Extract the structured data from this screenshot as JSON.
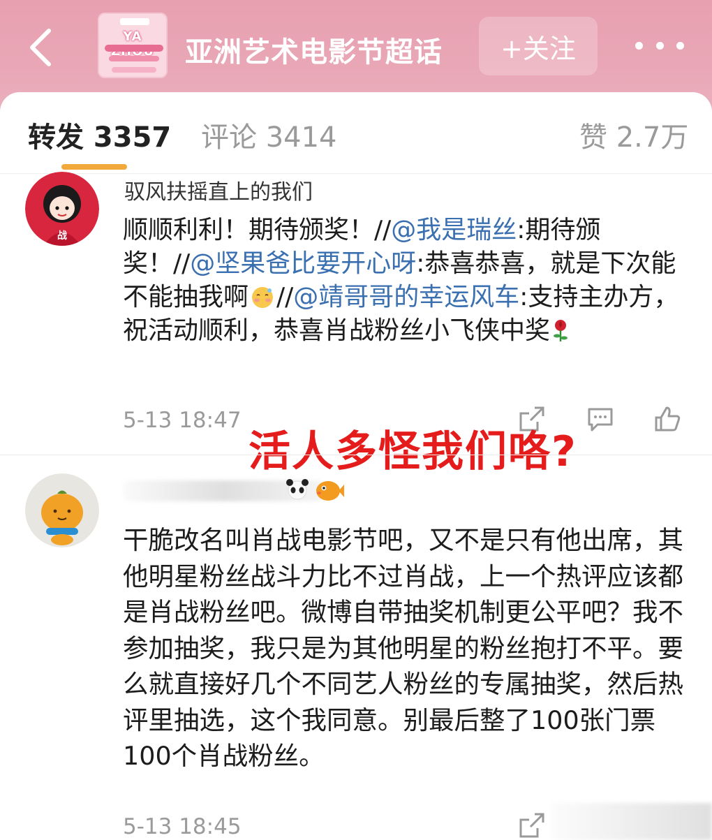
{
  "header": {
    "logo_text": "YA ZHOU",
    "title": "亚洲艺术电影节超话",
    "follow_label": "+关注"
  },
  "tabs": {
    "repost": "转发 3357",
    "comment": "评论 3414",
    "like": "赞 2.7万"
  },
  "posts": [
    {
      "author": "驭风扶摇直上的我们",
      "body": {
        "p1": "顺顺利利！期待颁奖！//",
        "m1": "@我是瑞丝",
        "p2": ":期待颁奖！//",
        "m2": "@坚果爸比要开心呀",
        "p3": ":恭喜恭喜，就是下次能不能抽我啊",
        "p4": "//",
        "m3": "@靖哥哥的幸运风车",
        "p5": ":支持主办方，祝活动顺利，恭喜肖战粉丝小飞侠中奖"
      },
      "time": "5-13 18:47"
    },
    {
      "author": "",
      "body": "干脆改名叫肖战电影节吧，又不是只有他出席，其他明星粉丝战斗力比不过肖战，上一个热评应该都是肖战粉丝吧。微博自带抽奖机制更公平吧？我不参加抽奖，我只是为其他明星的粉丝抱打不平。要么就直接好几个不同艺人粉丝的专属抽奖，然后热评里抽选，这个我同意。别最后整了100张门票100个肖战粉丝。",
      "time": "5-13 18:45"
    }
  ],
  "overlay_caption": "活人多怪我们咯?",
  "colors": {
    "header_pink": "#e7a0b0",
    "mention_blue": "#3a6fb0",
    "tab_underline": "#f2a93b",
    "caption_red": "#e51c1c"
  },
  "icons": [
    "back-arrow-icon",
    "more-icon",
    "share-icon",
    "comment-icon",
    "like-icon",
    "shy-emoji-icon",
    "rose-emoji-icon",
    "fish-emoji-icon"
  ]
}
